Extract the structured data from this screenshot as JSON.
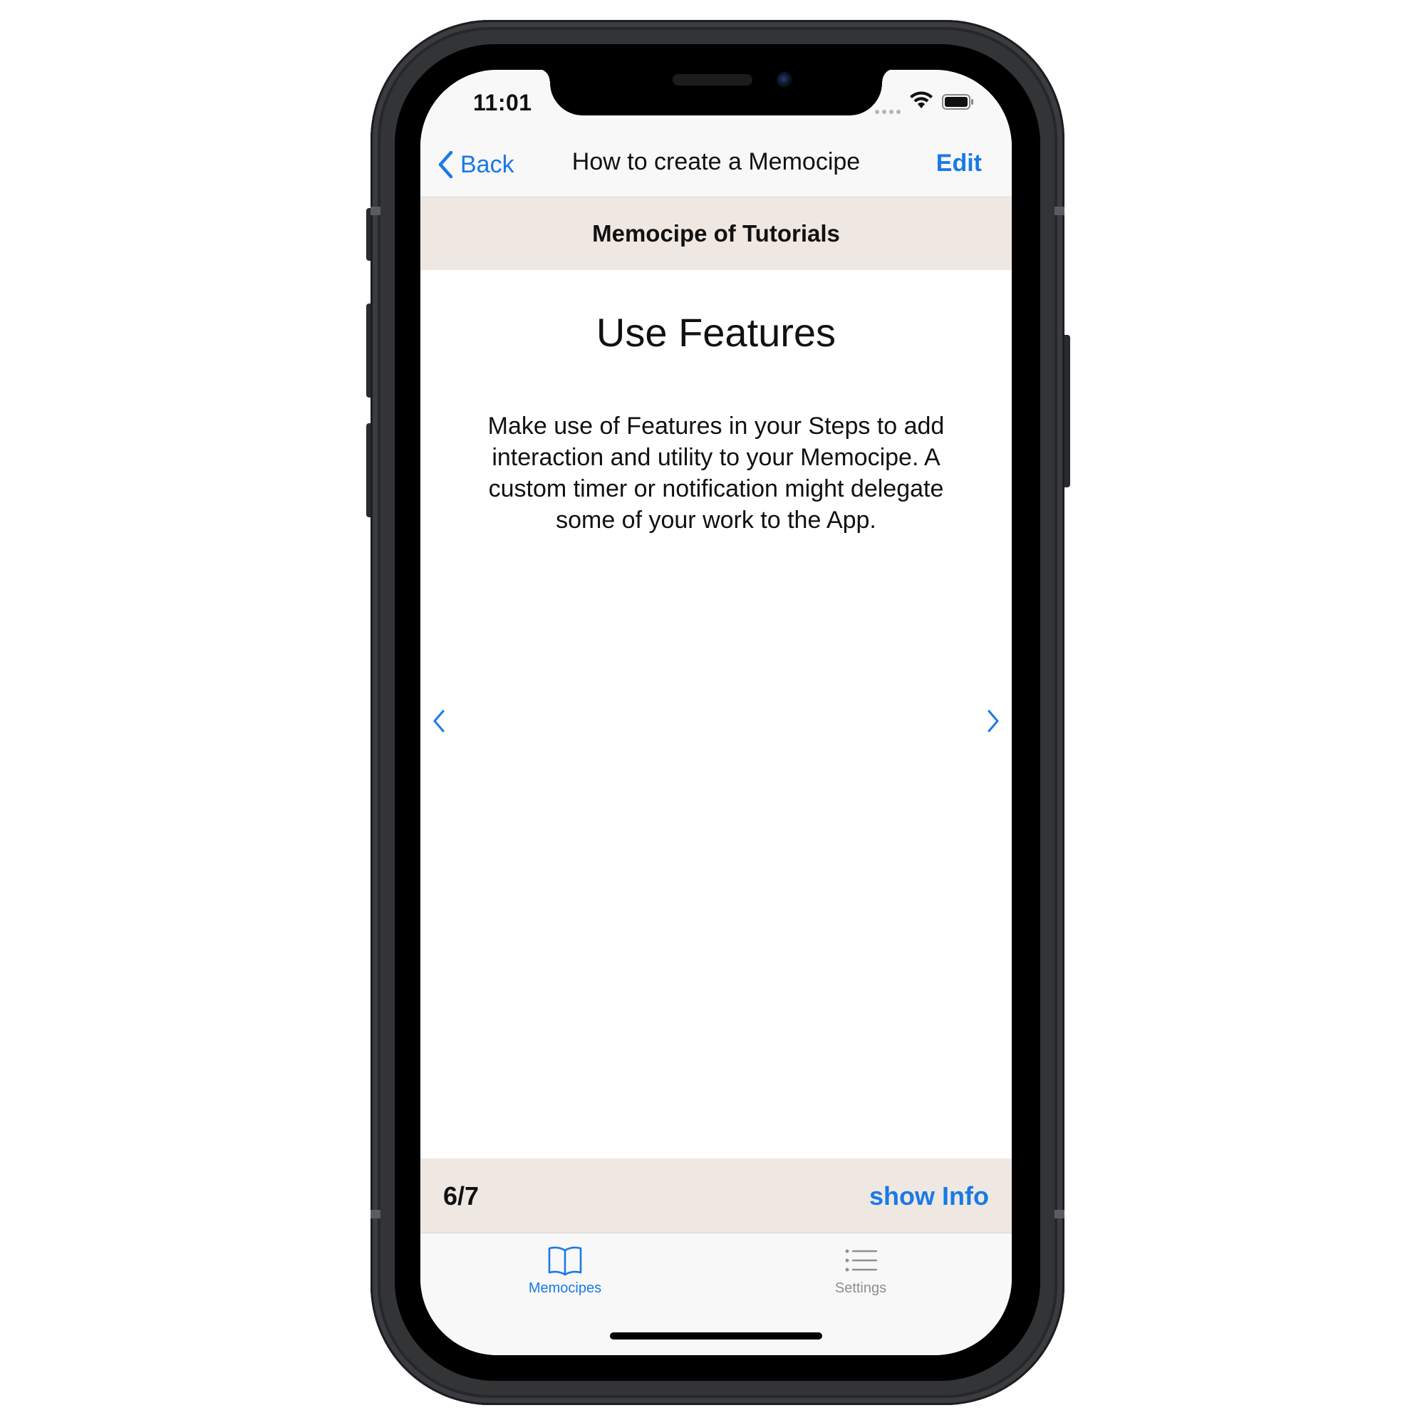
{
  "status_bar": {
    "time": "11:01"
  },
  "nav": {
    "back_label": "Back",
    "title": "How to create a Memocipe",
    "edit_label": "Edit"
  },
  "section": {
    "header": "Memocipe of Tutorials"
  },
  "step": {
    "title": "Use Features",
    "body": "Make use of Features in your Steps to add interaction and utility to your Memocipe. A custom timer or notification might delegate some of your work to the App."
  },
  "footer": {
    "page_indicator": "6/7",
    "show_info_label": "show Info"
  },
  "tab_bar": {
    "tabs": [
      {
        "label": "Memocipes",
        "icon": "book-icon",
        "selected": true
      },
      {
        "label": "Settings",
        "icon": "list-icon",
        "selected": false
      }
    ]
  },
  "colors": {
    "accent": "#1a7ae6",
    "header_bg": "#efe8e2",
    "bar_bg": "#f8f8f8",
    "inactive_tab": "#8e8e93"
  }
}
